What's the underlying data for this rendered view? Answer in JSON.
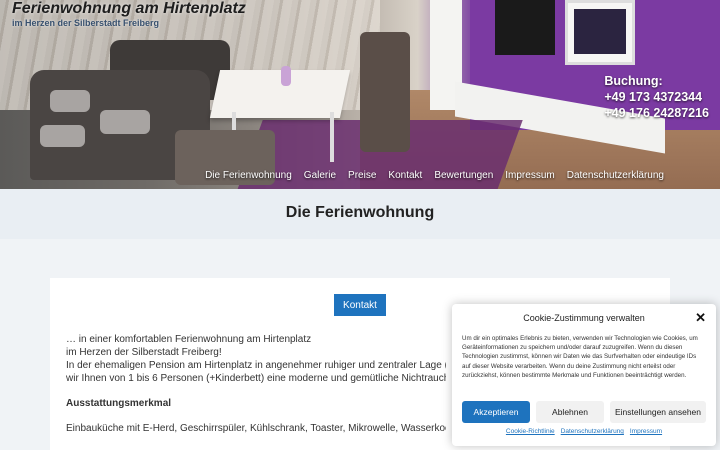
{
  "site": {
    "title": "Ferienwohnung am Hirtenplatz",
    "subtitle": "im Herzen der Silberstadt Freiberg"
  },
  "booking": {
    "label": "Buchung:",
    "phone1": "+49 173 4372344",
    "phone2": "+49 176 24287216"
  },
  "nav": {
    "items": [
      {
        "label": "Die Ferienwohnung"
      },
      {
        "label": "Galerie"
      },
      {
        "label": "Preise"
      },
      {
        "label": "Kontakt"
      },
      {
        "label": "Bewertungen"
      },
      {
        "label": "Impressum"
      },
      {
        "label": "Datenschutzerklärung"
      }
    ]
  },
  "page": {
    "title": "Die Ferienwohnung",
    "kontakt_button": "Kontakt",
    "lines": [
      "… in einer komfortablen Ferienwohnung am Hirtenplatz",
      "im Herzen der Silberstadt Freiberg!",
      "In der ehemaligen Pension am Hirtenplatz in angenehmer ruhiger und zentraler Lage (5 Mi",
      "wir Ihnen von 1 bis 6 Personen (+Kinderbett) eine moderne und gemütliche Nichtraucherg"
    ],
    "section_heading": "Ausstattungsmerkmal",
    "features_line": "Einbauküche mit E-Herd, Geschirrspüler, Kühlschrank, Toaster, Mikrowelle, Wasserkocher, K"
  },
  "cookie": {
    "title": "Cookie-Zustimmung verwalten",
    "text": "Um dir ein optimales Erlebnis zu bieten, verwenden wir Technologien wie Cookies, um Geräteinformationen zu speichern und/oder darauf zuzugreifen. Wenn du diesen Technologien zustimmst, können wir Daten wie das Surfverhalten oder eindeutige IDs auf dieser Website verarbeiten. Wenn du deine Zustimmung nicht erteilst oder zurückziehst, können bestimmte Merkmale und Funktionen beeinträchtigt werden.",
    "accept": "Akzeptieren",
    "deny": "Ablehnen",
    "prefs": "Einstellungen ansehen",
    "links": [
      "Cookie-Richtlinie",
      "Datenschutzerklärung",
      "Impressum"
    ]
  },
  "colors": {
    "accent": "#1e73be",
    "header_purple": "#7b3aa2"
  }
}
